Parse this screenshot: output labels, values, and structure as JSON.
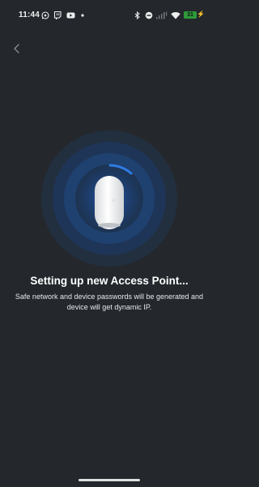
{
  "status_bar": {
    "time": "11:44",
    "battery_level": "31"
  },
  "navigation": {
    "back_icon": "chevron-left-icon"
  },
  "main": {
    "title": "Setting up new Access Point...",
    "subtitle": "Safe network and device passwords will be generated and device will get dynamic IP."
  },
  "colors": {
    "background": "#24282d",
    "accent": "#2f7be3",
    "battery": "#2e9b3a"
  }
}
